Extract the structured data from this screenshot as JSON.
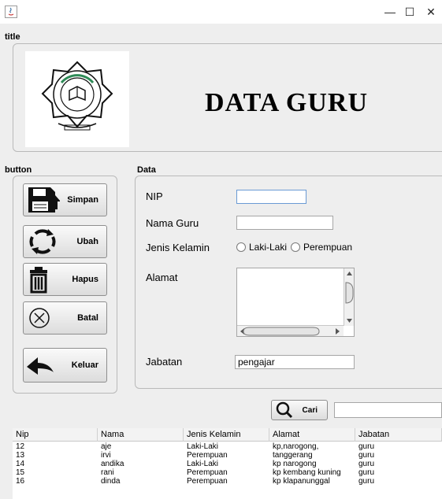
{
  "window": {
    "minimize": "—",
    "maximize": "☐",
    "close": "✕"
  },
  "sections": {
    "title": "title",
    "button": "button",
    "data": "Data"
  },
  "header": {
    "heading": "DATA GURU"
  },
  "buttons": {
    "simpan": "Simpan",
    "ubah": "Ubah",
    "hapus": "Hapus",
    "batal": "Batal",
    "keluar": "Keluar",
    "cari": "Cari"
  },
  "form": {
    "nip_label": "NIP",
    "nip_value": "",
    "nama_label": "Nama Guru",
    "nama_value": "",
    "jk_label": "Jenis Kelamin",
    "jk_option_1": "Laki-Laki",
    "jk_option_2": "Perempuan",
    "alamat_label": "Alamat",
    "alamat_value": "",
    "jabatan_label": "Jabatan",
    "jabatan_value": "pengajar"
  },
  "search": {
    "value": ""
  },
  "table": {
    "columns": [
      "Nip",
      "Nama",
      "Jenis Kelamin",
      "Alamat",
      "Jabatan"
    ],
    "rows": [
      [
        "12",
        "aje",
        "Laki-Laki",
        "kp,narogong,",
        "guru"
      ],
      [
        "13",
        "irvi",
        "Perempuan",
        "tanggerang",
        "guru"
      ],
      [
        "14",
        "andika",
        "Laki-Laki",
        "kp narogong",
        "guru"
      ],
      [
        "15",
        "rani",
        "Perempuan",
        "kp kembang kuning",
        "guru"
      ],
      [
        "16",
        "dinda",
        "Perempuan",
        "kp klapanunggal",
        "guru"
      ]
    ]
  },
  "icons": {
    "app": "java-icon",
    "logo": "school-logo",
    "simpan": "save-icon",
    "ubah": "refresh-icon",
    "hapus": "trash-icon",
    "batal": "cancel-icon",
    "keluar": "back-arrow-icon",
    "cari": "search-icon"
  }
}
